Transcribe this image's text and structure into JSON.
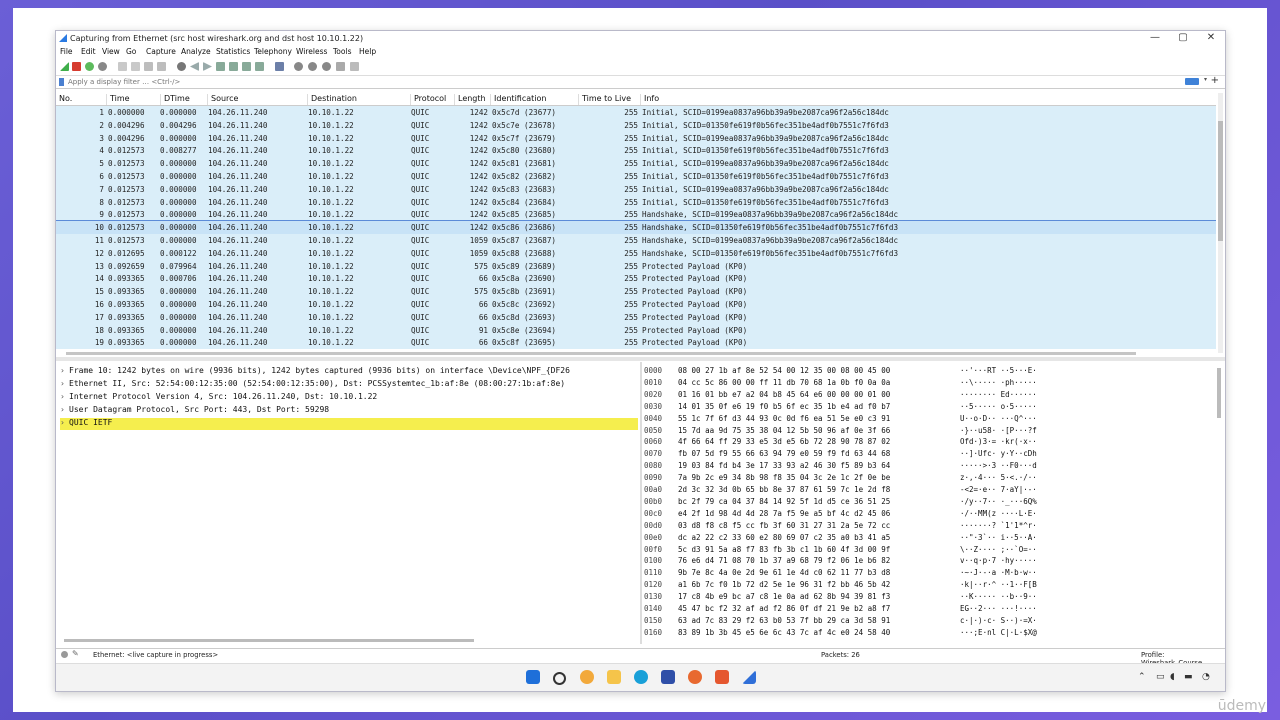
{
  "window": {
    "title": "Capturing from Ethernet (src host wireshark.org and dst host 10.10.1.22)",
    "controls": [
      "—",
      "▢",
      "✕"
    ]
  },
  "menu": [
    "File",
    "Edit",
    "View",
    "Go",
    "Capture",
    "Analyze",
    "Statistics",
    "Telephony",
    "Wireless",
    "Tools",
    "Help"
  ],
  "filter": {
    "placeholder": "Apply a display filter … <Ctrl-/>"
  },
  "columns": [
    "No.",
    "Time",
    "DTime",
    "Source",
    "Destination",
    "Protocol",
    "Length",
    "Identification",
    "Time to Live",
    "Info"
  ],
  "packets": [
    [
      "1",
      "0.000000",
      "0.000000",
      "104.26.11.240",
      "10.10.1.22",
      "QUIC",
      "1242",
      "0x5c7d (23677)",
      "255",
      "Initial, SCID=0199ea0837a96bb39a9be2087ca96f2a56c184dc"
    ],
    [
      "2",
      "0.004296",
      "0.004296",
      "104.26.11.240",
      "10.10.1.22",
      "QUIC",
      "1242",
      "0x5c7e (23678)",
      "255",
      "Initial, SCID=01350fe619f0b56fec351be4adf0b7551c7f6fd3"
    ],
    [
      "3",
      "0.004296",
      "0.000000",
      "104.26.11.240",
      "10.10.1.22",
      "QUIC",
      "1242",
      "0x5c7f (23679)",
      "255",
      "Initial, SCID=0199ea0837a96bb39a9be2087ca96f2a56c184dc"
    ],
    [
      "4",
      "0.012573",
      "0.008277",
      "104.26.11.240",
      "10.10.1.22",
      "QUIC",
      "1242",
      "0x5c80 (23680)",
      "255",
      "Initial, SCID=01350fe619f0b56fec351be4adf0b7551c7f6fd3"
    ],
    [
      "5",
      "0.012573",
      "0.000000",
      "104.26.11.240",
      "10.10.1.22",
      "QUIC",
      "1242",
      "0x5c81 (23681)",
      "255",
      "Initial, SCID=0199ea0837a96bb39a9be2087ca96f2a56c184dc"
    ],
    [
      "6",
      "0.012573",
      "0.000000",
      "104.26.11.240",
      "10.10.1.22",
      "QUIC",
      "1242",
      "0x5c82 (23682)",
      "255",
      "Initial, SCID=01350fe619f0b56fec351be4adf0b7551c7f6fd3"
    ],
    [
      "7",
      "0.012573",
      "0.000000",
      "104.26.11.240",
      "10.10.1.22",
      "QUIC",
      "1242",
      "0x5c83 (23683)",
      "255",
      "Initial, SCID=0199ea0837a96bb39a9be2087ca96f2a56c184dc"
    ],
    [
      "8",
      "0.012573",
      "0.000000",
      "104.26.11.240",
      "10.10.1.22",
      "QUIC",
      "1242",
      "0x5c84 (23684)",
      "255",
      "Initial, SCID=01350fe619f0b56fec351be4adf0b7551c7f6fd3"
    ],
    [
      "9",
      "0.012573",
      "0.000000",
      "104.26.11.240",
      "10.10.1.22",
      "QUIC",
      "1242",
      "0x5c85 (23685)",
      "255",
      "Handshake, SCID=0199ea0837a96bb39a9be2087ca96f2a56c184dc"
    ],
    [
      "10",
      "0.012573",
      "0.000000",
      "104.26.11.240",
      "10.10.1.22",
      "QUIC",
      "1242",
      "0x5c86 (23686)",
      "255",
      "Handshake, SCID=01350fe619f0b56fec351be4adf0b7551c7f6fd3"
    ],
    [
      "11",
      "0.012573",
      "0.000000",
      "104.26.11.240",
      "10.10.1.22",
      "QUIC",
      "1059",
      "0x5c87 (23687)",
      "255",
      "Handshake, SCID=0199ea0837a96bb39a9be2087ca96f2a56c184dc"
    ],
    [
      "12",
      "0.012695",
      "0.000122",
      "104.26.11.240",
      "10.10.1.22",
      "QUIC",
      "1059",
      "0x5c88 (23688)",
      "255",
      "Handshake, SCID=01350fe619f0b56fec351be4adf0b7551c7f6fd3"
    ],
    [
      "13",
      "0.092659",
      "0.079964",
      "104.26.11.240",
      "10.10.1.22",
      "QUIC",
      "575",
      "0x5c89 (23689)",
      "255",
      "Protected Payload (KP0)"
    ],
    [
      "14",
      "0.093365",
      "0.000706",
      "104.26.11.240",
      "10.10.1.22",
      "QUIC",
      "66",
      "0x5c8a (23690)",
      "255",
      "Protected Payload (KP0)"
    ],
    [
      "15",
      "0.093365",
      "0.000000",
      "104.26.11.240",
      "10.10.1.22",
      "QUIC",
      "575",
      "0x5c8b (23691)",
      "255",
      "Protected Payload (KP0)"
    ],
    [
      "16",
      "0.093365",
      "0.000000",
      "104.26.11.240",
      "10.10.1.22",
      "QUIC",
      "66",
      "0x5c8c (23692)",
      "255",
      "Protected Payload (KP0)"
    ],
    [
      "17",
      "0.093365",
      "0.000000",
      "104.26.11.240",
      "10.10.1.22",
      "QUIC",
      "66",
      "0x5c8d (23693)",
      "255",
      "Protected Payload (KP0)"
    ],
    [
      "18",
      "0.093365",
      "0.000000",
      "104.26.11.240",
      "10.10.1.22",
      "QUIC",
      "91",
      "0x5c8e (23694)",
      "255",
      "Protected Payload (KP0)"
    ],
    [
      "19",
      "0.093365",
      "0.000000",
      "104.26.11.240",
      "10.10.1.22",
      "QUIC",
      "66",
      "0x5c8f (23695)",
      "255",
      "Protected Payload (KP0)"
    ]
  ],
  "selected_packet": "10",
  "details": [
    "Frame 10: 1242 bytes on wire (9936 bits), 1242 bytes captured (9936 bits) on interface \\Device\\NPF_{DF26",
    "Ethernet II, Src: 52:54:00:12:35:00 (52:54:00:12:35:00), Dst: PCSSystemtec_1b:af:8e (08:00:27:1b:af:8e)",
    "Internet Protocol Version 4, Src: 104.26.11.240, Dst: 10.10.1.22",
    "User Datagram Protocol, Src Port: 443, Dst Port: 59298",
    "QUIC IETF"
  ],
  "details_expander": "›",
  "hex": [
    [
      "0000",
      "08 00 27 1b af 8e 52 54  00 12 35 00 08 00 45 00",
      "··'···RT ··5···E·"
    ],
    [
      "0010",
      "04 cc 5c 86 00 00 ff 11  db 70 68 1a 0b f0 0a 0a",
      "··\\····· ·ph·····"
    ],
    [
      "0020",
      "01 16 01 bb e7 a2 04 b8  45 64 e6 00 00 00 01 00",
      "········ Ed······"
    ],
    [
      "0030",
      "14 01 35 0f e6 19 f0 b5  6f ec 35 1b e4 ad f0 b7",
      "··5····· o·5·····"
    ],
    [
      "0040",
      "55 1c 7f 6f d3 44 93 0c  0d f6 ea 51 5e e0 c3 91",
      "U··o·D·· ···Q^···"
    ],
    [
      "0050",
      "15 7d aa 9d 75 35 38 04  12 5b 50 96 af 0e 3f 66",
      "·}··u58· ·[P···?f"
    ],
    [
      "0060",
      "4f 66 64 ff 29 33 e5 3d  e5 6b 72 28 90 78 87 02",
      "Ofd·)3·= ·kr(·x··"
    ],
    [
      "0070",
      "fb 07 5d f9 55 66 63 94  79 e0 59 f9 fd 63 44 68",
      "··]·Ufc· y·Y··cDh"
    ],
    [
      "0080",
      "19 03 84 fd b4 3e 17 33  93 a2 46 30 f5 89 b3 64",
      "·····>·3 ··F0···d"
    ],
    [
      "0090",
      "7a 9b 2c e9 34 8b 98 f8  35 04 3c 2e 1c 2f 0e be",
      "z·,·4··· 5·<.·/··"
    ],
    [
      "00a0",
      "2d 3c 32 3d 0b 65 bb 8e  37 87 61 59 7c 1e 2d f8",
      "-<2=·e·· 7·aY|·-·"
    ],
    [
      "00b0",
      "bc 2f 79 ca 04 37 84 14  92 5f 1d d5 ce 36 51 25",
      "·/y··7·· ·_···6Q%"
    ],
    [
      "00c0",
      "e4 2f 1d 98 4d 4d 28 7a  f5 9e a5 bf 4c d2 45 06",
      "·/··MM(z ····L·E·"
    ],
    [
      "00d0",
      "03 d8 f8 c8 f5 cc fb 3f  60 31 27 31 2a 5e 72 cc",
      "·······? `1'1*^r·"
    ],
    [
      "00e0",
      "dc a2 22 c2 33 60 e2 80  69 07 c2 35 a0 b3 41 a5",
      "··\"·3`·· i··5··A·"
    ],
    [
      "00f0",
      "5c d3 91 5a a8 f7 83 fb  3b c1 1b 60 4f 3d 00 9f",
      "\\··Z···· ;··`O=··"
    ],
    [
      "0100",
      "76 e6 d4 71 08 70 1b 37  a9 68 79 f2 06 1e b6 82",
      "v··q·p·7 ·hy·····"
    ],
    [
      "0110",
      "9b 7e 8c 4a 0e 2d 9e 61  1e 4d c0 62 11 77 b3 d8",
      "·~·J·-·a ·M·b·w··"
    ],
    [
      "0120",
      "a1 6b 7c f0 1b 72 d2 5e  1e 96 31 f2 bb 46 5b 42",
      "·k|··r·^ ··1··F[B"
    ],
    [
      "0130",
      "17 c8 4b e9 bc a7 c8 1e  0a ad 62 8b 94 39 81 f3",
      "··K····· ··b··9··"
    ],
    [
      "0140",
      "45 47 bc f2 32 af ad f2  86 0f df 21 9e b2 a8 f7",
      "EG··2··· ···!····"
    ],
    [
      "0150",
      "63 ad 7c 83 29 f2 63 b0  53 7f bb 29 ca 3d 58 91",
      "c·|·)·c· S··)·=X·"
    ],
    [
      "0160",
      "83 89 1b 3b 45 e5 6e 6c  43 7c af 4c e0 24 58 40",
      "···;E·nl C|·L·$X@"
    ]
  ],
  "status": {
    "left": "Ethernet: <live capture in progress>",
    "packets": "Packets: 26",
    "profile": "Profile: Wireshark_Course"
  },
  "watermark": "ūdemy",
  "colors": {
    "row_bg": "#daeef9",
    "selected_outline": "#5b8bd8",
    "highlight": "#f5ee4e"
  }
}
